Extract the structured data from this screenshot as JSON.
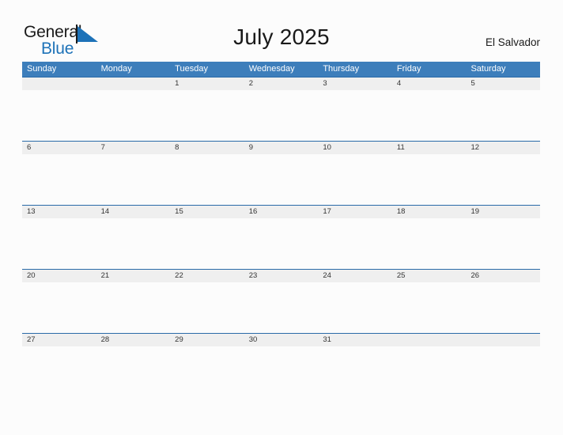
{
  "brand": {
    "name_part1": "General",
    "name_part2": "Blue",
    "flag_icon": "flag-triangle-icon"
  },
  "header": {
    "title": "July 2025",
    "locale": "El Salvador"
  },
  "calendar": {
    "weekdays": [
      "Sunday",
      "Monday",
      "Tuesday",
      "Wednesday",
      "Thursday",
      "Friday",
      "Saturday"
    ],
    "weeks": [
      [
        "",
        "",
        "1",
        "2",
        "3",
        "4",
        "5"
      ],
      [
        "6",
        "7",
        "8",
        "9",
        "10",
        "11",
        "12"
      ],
      [
        "13",
        "14",
        "15",
        "16",
        "17",
        "18",
        "19"
      ],
      [
        "20",
        "21",
        "22",
        "23",
        "24",
        "25",
        "26"
      ],
      [
        "27",
        "28",
        "29",
        "30",
        "31",
        "",
        ""
      ]
    ]
  },
  "colors": {
    "header_blue": "#3d7ebb",
    "row_divider_blue": "#2a6ba8",
    "date_band_gray": "#efefef",
    "brand_blue": "#1d72b8",
    "page_background": "#fcfcfc",
    "text_dark": "#1a1a1a"
  }
}
